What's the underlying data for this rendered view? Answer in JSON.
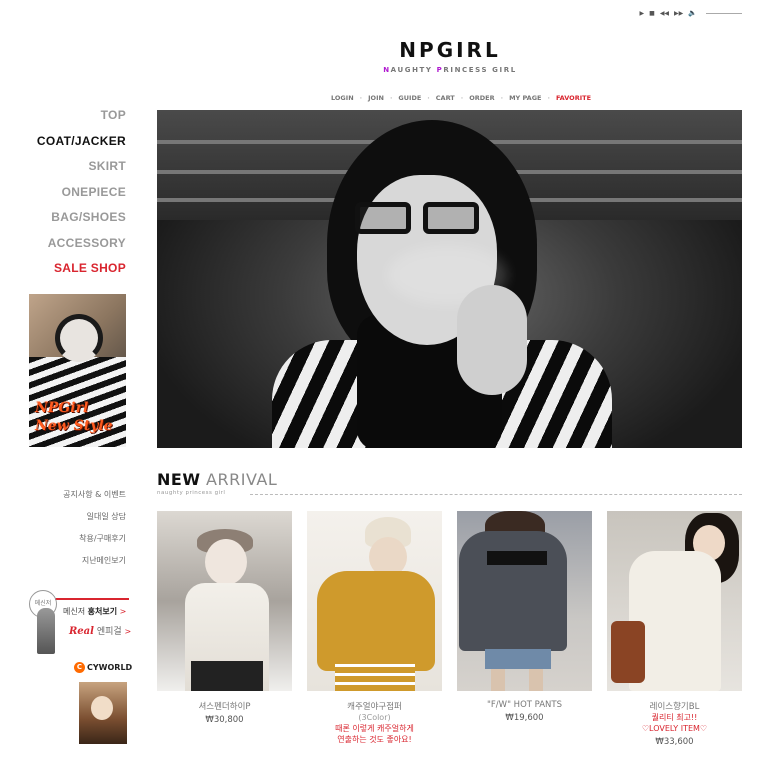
{
  "player": {
    "controls": [
      "▶",
      "■",
      "◀◀",
      "▶▶"
    ],
    "volume_icon": "🔈"
  },
  "brand": {
    "logo": "NPGIRL",
    "tagline_parts": [
      {
        "t": "N",
        "hl": true
      },
      {
        "t": "AUGHTY ",
        "hl": false
      },
      {
        "t": "P",
        "hl": true
      },
      {
        "t": "RINCESS GIRL",
        "hl": false
      }
    ]
  },
  "topnav": [
    "LOGIN",
    "JOIN",
    "GUIDE",
    "CART",
    "ORDER",
    "MY PAGE",
    "FAVORITE"
  ],
  "categories": [
    {
      "label": "TOP",
      "state": ""
    },
    {
      "label": "COAT/JACKER",
      "state": "active"
    },
    {
      "label": "SKIRT",
      "state": ""
    },
    {
      "label": "ONEPIECE",
      "state": ""
    },
    {
      "label": "BAG/SHOES",
      "state": ""
    },
    {
      "label": "ACCESSORY",
      "state": ""
    },
    {
      "label": "SALE SHOP",
      "state": "sale"
    }
  ],
  "side_promo": {
    "line1": "NPGirl",
    "line2": "New Style"
  },
  "notice_links": [
    "공지사항 & 이벤트",
    "일대일 상담",
    "착용/구매후기",
    "지난메인보기"
  ],
  "messenger": {
    "badge": "메신저",
    "line1_prefix": "메신저 ",
    "line1_bold": "홍처보기",
    "line2_real": "Real",
    "line2_rest": " 엔피걸",
    "arrow": ">"
  },
  "cyworld": {
    "label": "CYWORLD",
    "mark": "C"
  },
  "new_arrival": {
    "title_bold": "NEW",
    "title_light": " ARRIVAL",
    "subtitle": "naughty princess girl"
  },
  "products": [
    {
      "name": "셔스펜더하이P",
      "price": "₩30,800",
      "notes": []
    },
    {
      "name": "캐주얼야구점퍼",
      "sub": "(3Color)",
      "price": "",
      "notes": [
        "때론 이렇게 캐주얼하게",
        "연출하는 것도 좋아요!"
      ]
    },
    {
      "name": "\"F/W\" HOT PANTS",
      "price": "₩19,600",
      "notes": []
    },
    {
      "name": "레이스향기BL",
      "price": "₩33,600",
      "notes": [
        "퀄리티 최고!!",
        "♡LOVELY ITEM♡"
      ]
    }
  ],
  "colors": {
    "accent_red": "#d9252f",
    "logo_highlight": "#b01ad0"
  }
}
